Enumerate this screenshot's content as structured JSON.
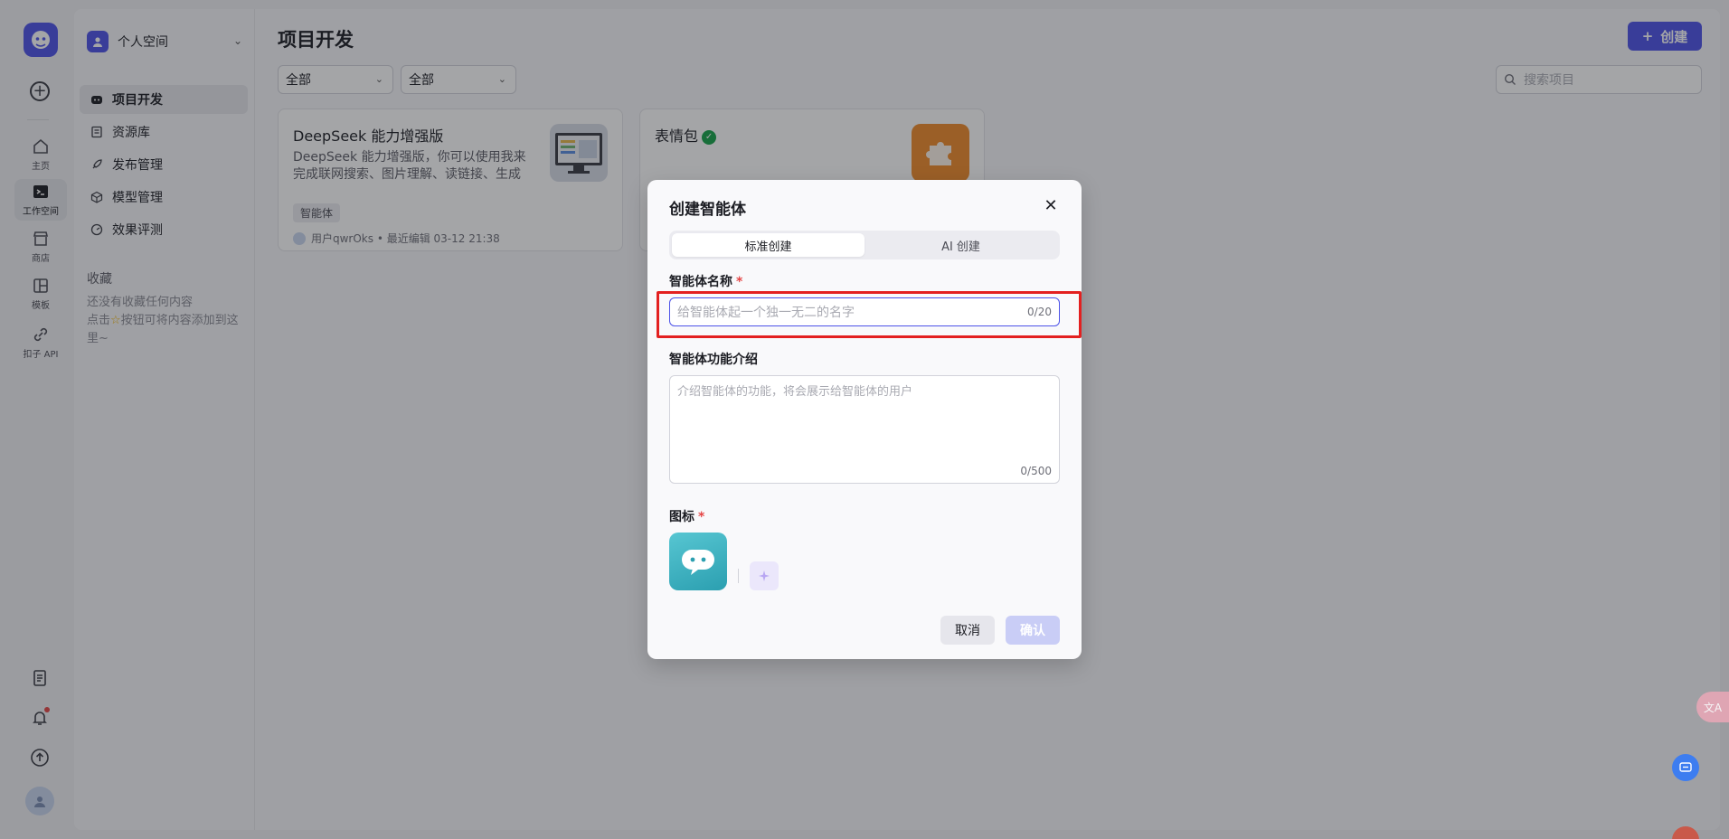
{
  "rail": {
    "items": [
      {
        "label": "主页",
        "icon": "home-icon"
      },
      {
        "label": "工作空间",
        "icon": "terminal-icon"
      },
      {
        "label": "商店",
        "icon": "store-icon"
      },
      {
        "label": "模板",
        "icon": "template-icon"
      },
      {
        "label": "扣子 API",
        "icon": "link-icon"
      }
    ]
  },
  "sidebar": {
    "space_name": "个人空间",
    "nav": [
      "项目开发",
      "资源库",
      "发布管理",
      "模型管理",
      "效果评测"
    ],
    "favorites_title": "收藏",
    "favorites_empty_line1": "还没有收藏任何内容",
    "favorites_empty_line2_a": "点击",
    "favorites_empty_line2_b": "按钮可将内容添加到这里~"
  },
  "main": {
    "title": "项目开发",
    "create_label": "创建",
    "filters": [
      "全部",
      "全部"
    ],
    "search_placeholder": "搜索项目",
    "cards": [
      {
        "title": "DeepSeek 能力增强版",
        "desc": "DeepSeek 能力增强版，你可以使用我来完成联网搜索、图片理解、读链接、生成图…",
        "tag": "智能体",
        "meta": "用户qwrOks • 最近编辑 03-12 21:38"
      },
      {
        "title": "表情包",
        "verified": true
      }
    ]
  },
  "modal": {
    "title": "创建智能体",
    "tabs": [
      "标准创建",
      "AI 创建"
    ],
    "active_tab": "标准创建",
    "name_label": "智能体名称",
    "name_placeholder": "给智能体起一个独一无二的名字",
    "name_counter": "0/20",
    "desc_label": "智能体功能介绍",
    "desc_placeholder": "介绍智能体的功能，将会展示给智能体的用户",
    "desc_counter": "0/500",
    "icon_label": "图标",
    "required_mark": "*",
    "cancel_label": "取消",
    "confirm_label": "确认"
  },
  "colors": {
    "accent": "#4d53e8",
    "highlight": "#e32020",
    "required": "#e54545"
  }
}
